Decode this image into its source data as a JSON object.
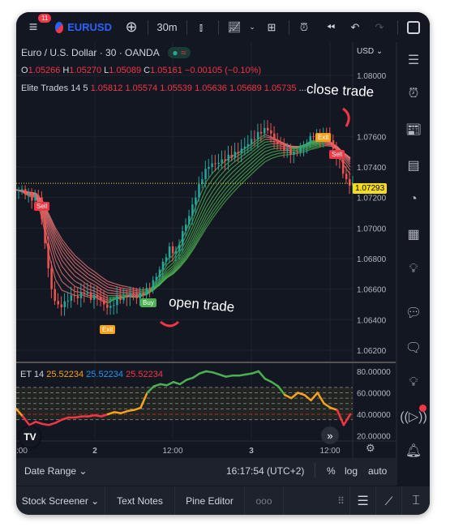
{
  "toolbar": {
    "notifications": "11",
    "symbol": "EURUSD",
    "interval": "30m"
  },
  "legend": {
    "title": "Euro / U.S. Dollar · 30 · OANDA",
    "o_label": "O",
    "o": "1.05266",
    "h_label": "H",
    "h": "1.05270",
    "l_label": "L",
    "l": "1.05089",
    "c_label": "C",
    "c": "1.05161",
    "change": "−0.00105 (−0.10%)",
    "indicator": "Elite Trades 14 5",
    "ind_values": [
      "1.05812",
      "1.05574",
      "1.05539",
      "1.05636",
      "1.05689",
      "1.05735"
    ],
    "more": "..."
  },
  "price_axis": {
    "currency": "USD",
    "labels": [
      "1.08000",
      "1.07600",
      "1.07400",
      "1.07200",
      "1.07000",
      "1.06800",
      "1.06600",
      "1.06400",
      "1.06200"
    ],
    "last_price": "1.07293",
    "last_color": "#f7dc1b"
  },
  "annotations": {
    "close_trade": "close trade",
    "open_trade": "open trade",
    "sell1": "Sell",
    "exit1": "Exit",
    "buy": "Buy",
    "exit2": "Exit",
    "sell2": "Sell"
  },
  "indicator": {
    "label": "ET 14",
    "v1": "25.52234",
    "v2": "25.52234",
    "v3": "25.52234",
    "axis": [
      "80.00000",
      "60.00000",
      "40.00000",
      "20.00000"
    ]
  },
  "time_axis": [
    ":00",
    "2",
    "12:00",
    "3",
    "12:00"
  ],
  "status": {
    "date_range": "Date Range",
    "clock": "16:17:54 (UTC+2)",
    "percent": "%",
    "log": "log",
    "auto": "auto"
  },
  "tabs": [
    "Stock Screener",
    "Text Notes",
    "Pine Editor",
    "ooo"
  ],
  "colors": {
    "up": "#26a69a",
    "down": "#ef5350",
    "ribbon_up": "#4caf50",
    "ribbon_down": "#e57373"
  },
  "chart_data": {
    "type": "candlestick",
    "ylim": [
      1.0612,
      1.0808
    ],
    "closes": [
      1.0725,
      1.0722,
      1.0718,
      1.072,
      1.069,
      1.066,
      1.065,
      1.0652,
      1.0656,
      1.0654,
      1.0657,
      1.0653,
      1.0655,
      1.065,
      1.0649,
      1.0656,
      1.0655,
      1.0657,
      1.0654,
      1.0656,
      1.066,
      1.0668,
      1.0678,
      1.0688,
      1.0685,
      1.0698,
      1.0708,
      1.072,
      1.0732,
      1.074,
      1.0742,
      1.0745,
      1.0748,
      1.075,
      1.0752,
      1.0755,
      1.0758,
      1.0762,
      1.0764,
      1.0758,
      1.0755,
      1.0752,
      1.075,
      1.0753,
      1.0756,
      1.076,
      1.0758,
      1.0762,
      1.0752,
      1.0745,
      1.0732,
      1.0729
    ],
    "et_values": [
      45,
      38,
      30,
      33,
      31,
      30,
      32,
      35,
      37,
      37,
      38,
      38,
      39,
      38,
      40,
      42,
      41,
      43,
      44,
      46,
      60,
      66,
      68,
      67,
      70,
      68,
      72,
      74,
      78,
      80,
      79,
      77,
      75,
      76,
      76,
      77,
      78,
      80,
      73,
      70,
      66,
      58,
      55,
      60,
      58,
      53,
      60,
      50,
      46,
      44,
      30,
      40
    ],
    "et_ylim": [
      18,
      86
    ]
  }
}
